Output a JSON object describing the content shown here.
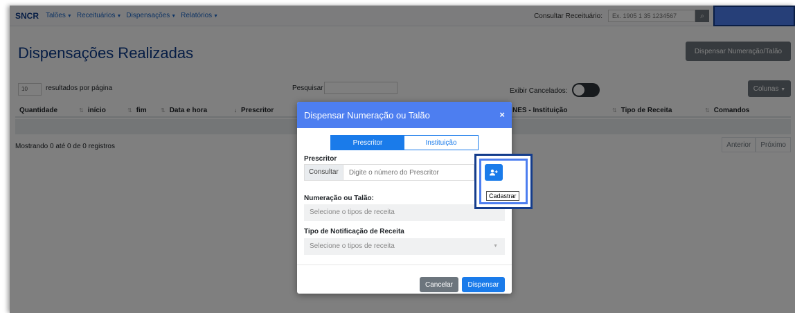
{
  "navbar": {
    "brand": "SNCR",
    "items": [
      {
        "label": "Talões"
      },
      {
        "label": "Receituários"
      },
      {
        "label": "Dispensações"
      },
      {
        "label": "Relatórios"
      }
    ],
    "consult_label": "Consultar Receituário:",
    "consult_placeholder": "Ex. 1905 1 35 1234567",
    "search_icon": "search-icon"
  },
  "page": {
    "title": "Dispensações Realizadas",
    "dispensar_button": "Dispensar Numeração/Talão",
    "per_page_value": "10",
    "per_page_label": "resultados por página",
    "search_label": "Pesquisar",
    "cancelados_label": "Exibir Cancelados:",
    "colunas_button": "Colunas"
  },
  "table": {
    "columns": [
      {
        "label": "Quantidade"
      },
      {
        "label": "início"
      },
      {
        "label": "fim"
      },
      {
        "label": "Data e hora"
      },
      {
        "label": "Prescritor"
      },
      {
        "label": "NES - Instituição"
      },
      {
        "label": "Tipo de Receita"
      },
      {
        "label": "Comandos"
      }
    ],
    "info": "Mostrando 0 até 0 de 0 registros",
    "prev": "Anterior",
    "next": "Próximo"
  },
  "modal": {
    "title": "Dispensar Numeração ou Talão",
    "close": "×",
    "tabs": [
      {
        "label": "Prescritor",
        "active": true
      },
      {
        "label": "Instituição",
        "active": false
      }
    ],
    "prescritor_label": "Prescritor",
    "consultar_addon": "Consultar",
    "prescritor_placeholder": "Digite o número do Prescritor",
    "add_icon": "add-user-icon",
    "tooltip": "Cadastrar",
    "numeracao_label": "Numeração ou Talão:",
    "numeracao_placeholder": "Selecione o tipos de receita",
    "tipo_label": "Tipo de Notificação de Receita",
    "tipo_placeholder": "Selecione o tipos de receita",
    "cancel_button": "Cancelar",
    "submit_button": "Dispensar"
  },
  "colors": {
    "primary": "#1a7bea",
    "modal_header": "#4d7ef0",
    "highlight_border": "#143c8c",
    "title": "#0d3b8a"
  }
}
